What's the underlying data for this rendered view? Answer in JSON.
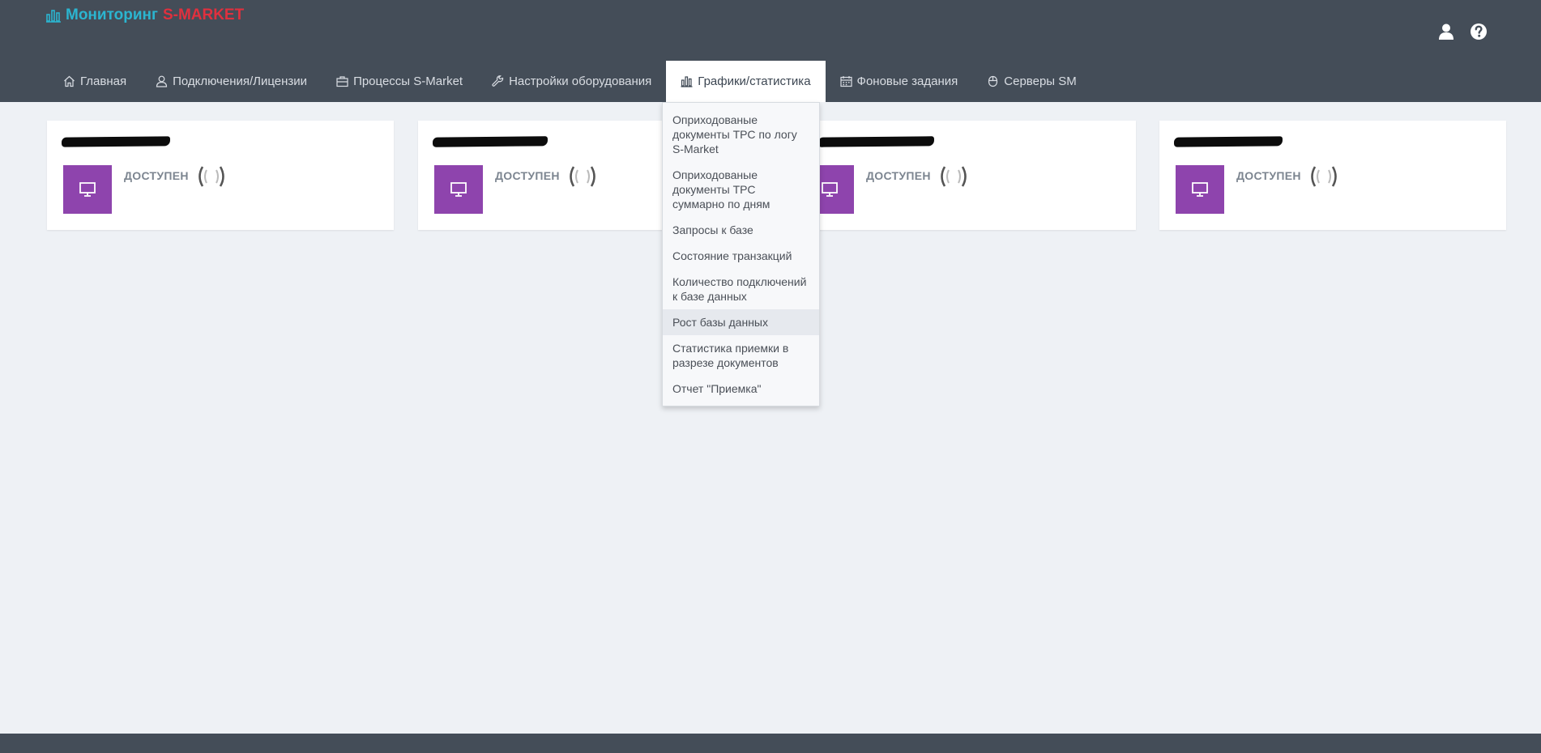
{
  "brand": {
    "part1": "Мониторинг",
    "part2": "S-MARKET"
  },
  "colors": {
    "topbar": "#444d58",
    "brand_blue": "#2bb5d0",
    "brand_red": "#e0303e",
    "tile": "#8e44ad"
  },
  "header_icons": [
    "user-icon",
    "help-icon"
  ],
  "nav": [
    {
      "label": "Главная",
      "icon": "home-icon"
    },
    {
      "label": "Подключения/Лицензии",
      "icon": "user-outline-icon"
    },
    {
      "label": "Процессы S-Market",
      "icon": "briefcase-icon"
    },
    {
      "label": "Настройки оборудования",
      "icon": "wrench-icon"
    },
    {
      "label": "Графики/статистика",
      "icon": "bar-chart-icon",
      "active": true
    },
    {
      "label": "Фоновые задания",
      "icon": "calendar-icon"
    },
    {
      "label": "Серверы SM",
      "icon": "mouse-icon"
    }
  ],
  "cards": [
    {
      "status": "ДОСТУПЕН"
    },
    {
      "status": "ДОСТУПЕН"
    },
    {
      "status": "ДОСТУПЕН"
    },
    {
      "status": "ДОСТУПЕН"
    }
  ],
  "dropdown": {
    "items": [
      "Оприходованые документы ТРС по логу S-Market",
      "Оприходованые документы ТРС суммарно по дням",
      "Запросы к базе",
      "Состояние транзакций",
      "Количество подключений к базе данных",
      "Рост базы данных",
      "Статистика приемки в разрезе документов",
      "Отчет \"Приемка\""
    ],
    "hovered_index": 5
  }
}
